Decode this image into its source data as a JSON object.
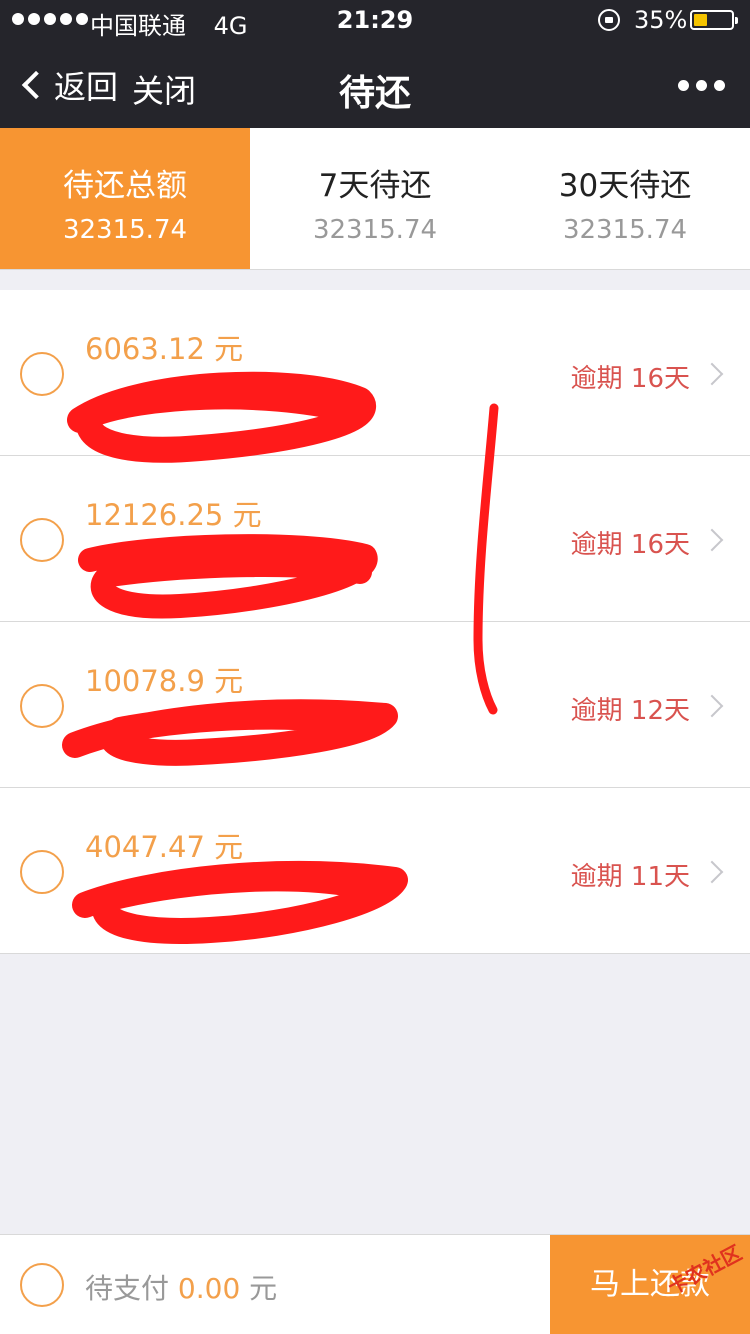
{
  "status_bar": {
    "carrier": "中国联通",
    "network": "4G",
    "time": "21:29",
    "battery_percent": "35%",
    "battery_level": 0.35
  },
  "nav": {
    "back_label": "返回",
    "close_label": "关闭",
    "title": "待还"
  },
  "tabs": [
    {
      "label": "待还总额",
      "value": "32315.74",
      "active": true
    },
    {
      "label": "7天待还",
      "value": "32315.74",
      "active": false
    },
    {
      "label": "30天待还",
      "value": "32315.74",
      "active": false
    }
  ],
  "items": [
    {
      "amount": "6063.12 元",
      "status": "逾期 16天"
    },
    {
      "amount": "12126.25 元",
      "status": "逾期 16天"
    },
    {
      "amount": "10078.9 元",
      "status": "逾期 12天"
    },
    {
      "amount": "4047.47 元",
      "status": "逾期 11天"
    }
  ],
  "bottom": {
    "pay_label": "待支付",
    "pay_amount": "0.00",
    "pay_unit": "元",
    "pay_button": "马上还款"
  },
  "watermark": {
    "text": "卡农社区"
  },
  "colors": {
    "accent": "#f79532",
    "amount": "#f3a04b",
    "overdue": "#d9534f",
    "header_bg": "#25252b",
    "redaction": "#ff1a1a"
  }
}
